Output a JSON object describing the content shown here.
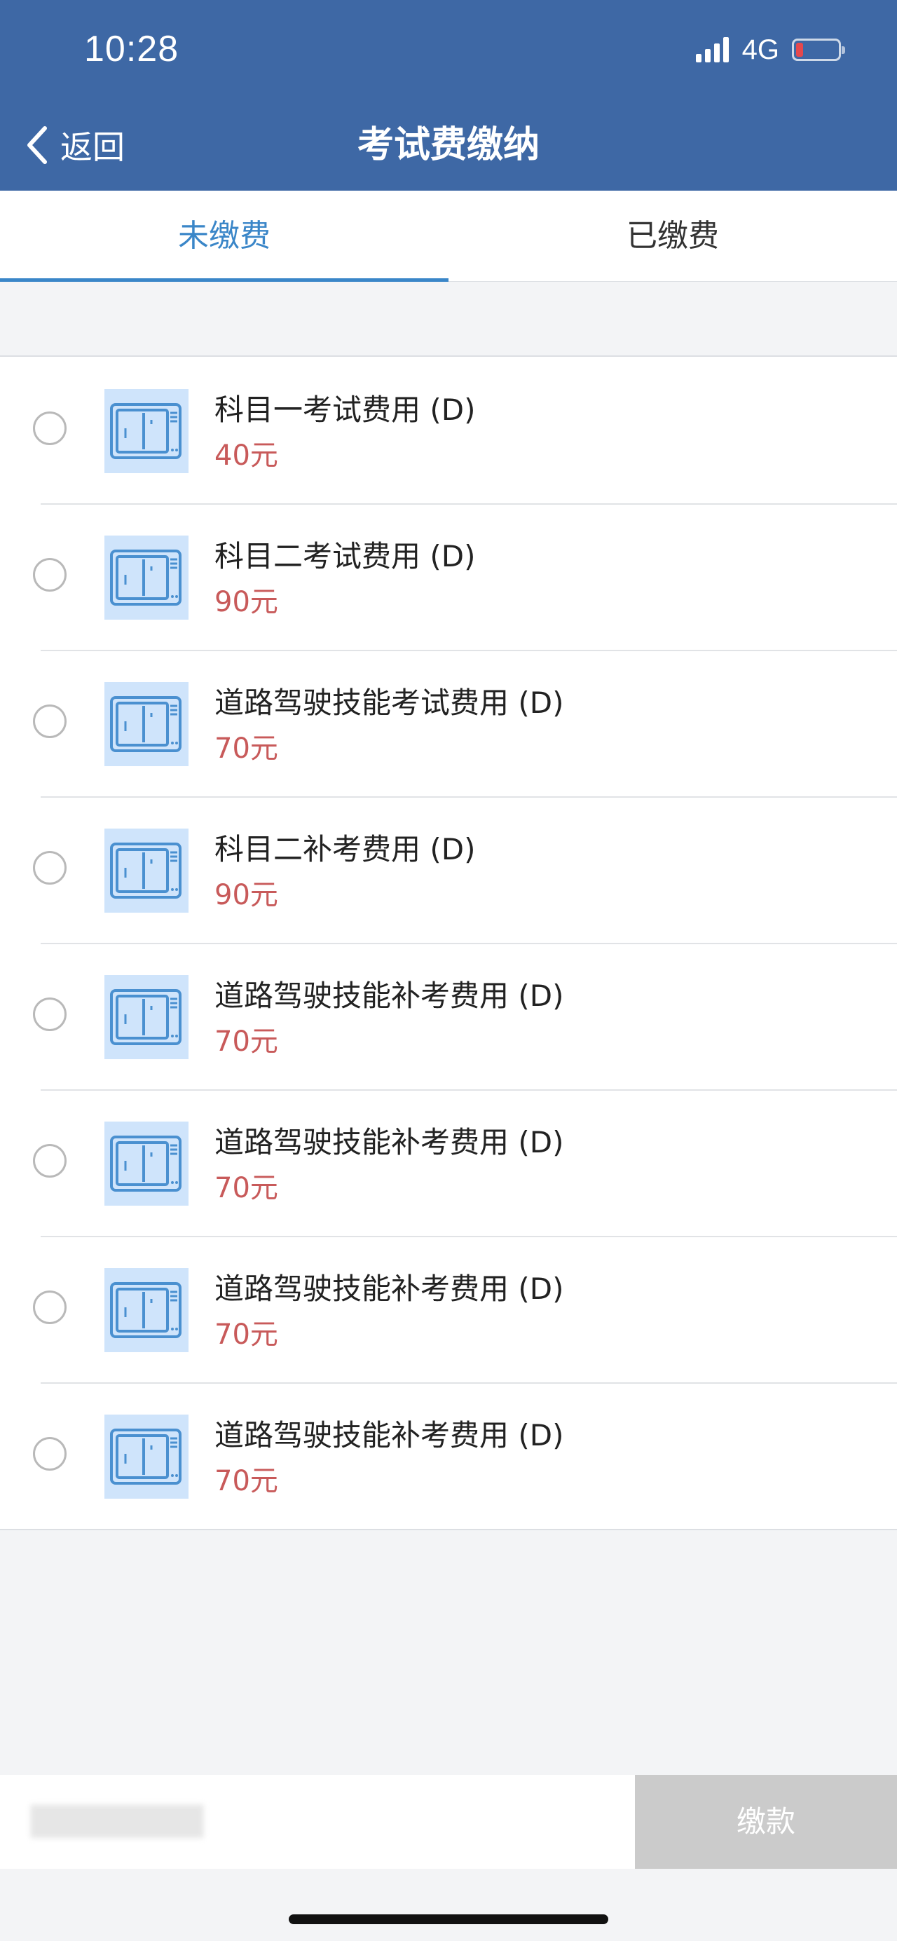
{
  "status_bar": {
    "time": "10:28",
    "network": "4G"
  },
  "nav": {
    "back_label": "返回",
    "title": "考试费缴纳"
  },
  "tabs": [
    {
      "label": "未缴费",
      "active": true
    },
    {
      "label": "已缴费",
      "active": false
    }
  ],
  "items": [
    {
      "title": "科目一考试费用 (D)",
      "price": "40元"
    },
    {
      "title": "科目二考试费用 (D)",
      "price": "90元"
    },
    {
      "title": "道路驾驶技能考试费用 (D)",
      "price": "70元"
    },
    {
      "title": "科目二补考费用 (D)",
      "price": "90元"
    },
    {
      "title": "道路驾驶技能补考费用 (D)",
      "price": "70元"
    },
    {
      "title": "道路驾驶技能补考费用 (D)",
      "price": "70元"
    },
    {
      "title": "道路驾驶技能补考费用 (D)",
      "price": "70元"
    },
    {
      "title": "道路驾驶技能补考费用 (D)",
      "price": "70元"
    }
  ],
  "footer": {
    "pay_label": "缴款"
  },
  "colors": {
    "nav_bg": "#3e68a5",
    "accent": "#3a86c8",
    "price": "#c85a5a",
    "pay_disabled": "#cbcbcb"
  },
  "icons": {
    "back": "chevron-left-icon",
    "item": "exam-card-icon"
  }
}
